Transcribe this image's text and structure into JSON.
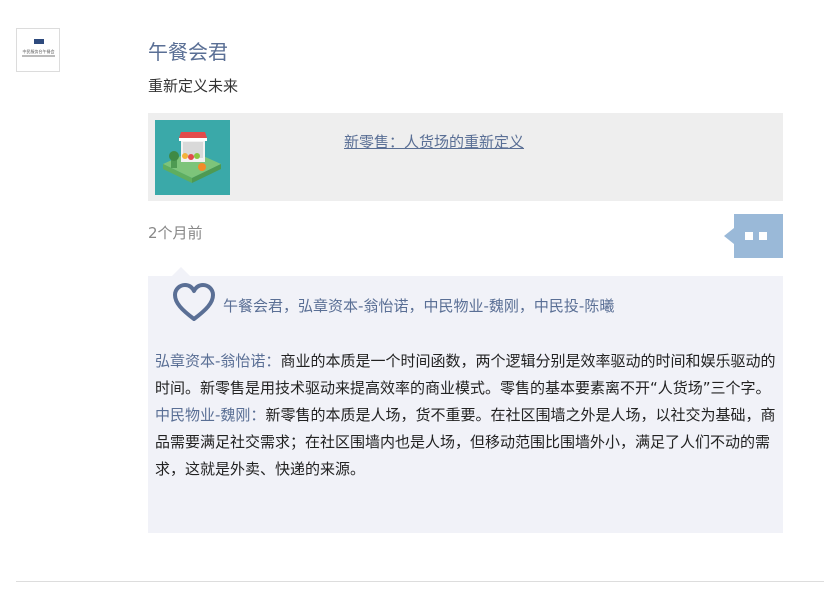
{
  "avatar": {
    "line1": "中民服务台午餐会",
    "line2": "CMI Luncheon"
  },
  "post": {
    "author": "午餐会君",
    "text": "重新定义未来",
    "share": {
      "title": "新零售：人货场的重新定义"
    },
    "time": "2个月前"
  },
  "likes": {
    "names": [
      "午餐会君",
      "弘章资本-翁怡诺",
      "中民物业-魏刚",
      "中民投-陈曦"
    ],
    "separator": "，"
  },
  "comments": [
    {
      "name": "弘章资本-翁怡诺",
      "colon": "：",
      "text": "商业的本质是一个时间函数，两个逻辑分别是效率驱动的时间和娱乐驱动的时间。新零售是用技术驱动来提高效率的商业模式。零售的基本要素离不开“人货场”三个字。"
    },
    {
      "name": "中民物业-魏刚",
      "colon": "：",
      "text": "新零售的本质是人场，货不重要。在社区围墙之外是人场，以社交为基础，商品需要满足社交需求；在社区围墙内也是人场，但移动范围比围墙外小，满足了人们不动的需求，这就是外卖、快递的来源。"
    }
  ],
  "colors": {
    "link": "#5a6f95",
    "panel_bg": "#f1f2f8",
    "share_bg": "#eeeeee",
    "comment_button": "#9ab9d8"
  },
  "icons": {
    "heart": "heart-outline-icon",
    "comment": "comment-bubble-icon"
  }
}
